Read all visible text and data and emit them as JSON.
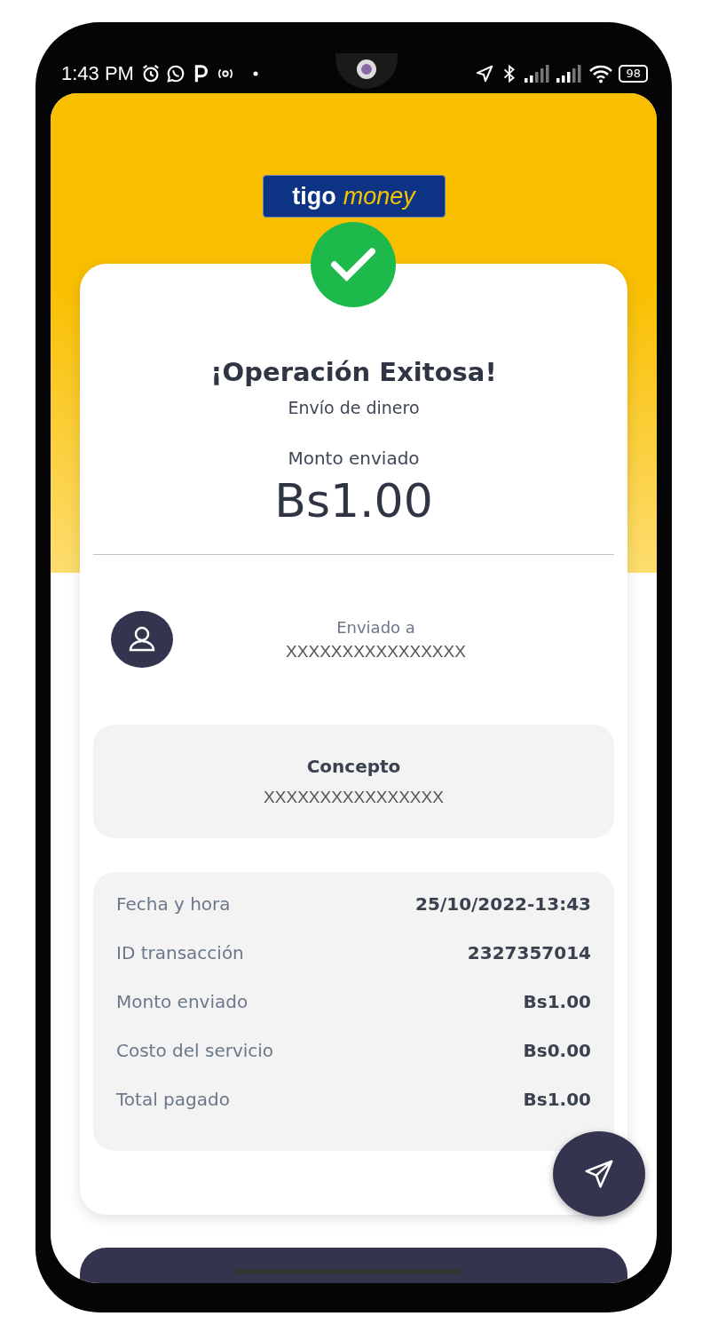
{
  "status_bar": {
    "time": "1:43 PM",
    "battery": "98"
  },
  "logo": {
    "left": "tigo",
    "right": "money"
  },
  "result": {
    "title": "¡Operación Exitosa!",
    "subtitle": "Envío de dinero",
    "amount_label": "Monto enviado",
    "amount": "Bs1.00"
  },
  "recipient": {
    "label": "Enviado a",
    "value": "XXXXXXXXXXXXXXXX"
  },
  "concept": {
    "label": "Concepto",
    "value": "XXXXXXXXXXXXXXXX"
  },
  "details": [
    {
      "label": "Fecha y hora",
      "value": "25/10/2022-13:43"
    },
    {
      "label": "ID transacción",
      "value": "2327357014"
    },
    {
      "label": "Monto enviado",
      "value": "Bs1.00"
    },
    {
      "label": "Costo del servicio",
      "value": "Bs0.00"
    },
    {
      "label": "Total pagado",
      "value": "Bs1.00"
    }
  ]
}
